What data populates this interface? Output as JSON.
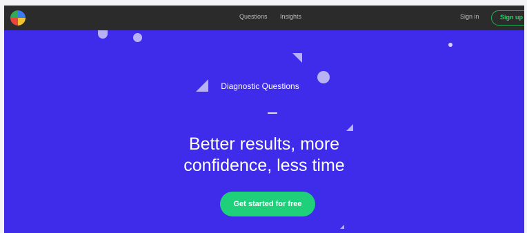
{
  "nav": {
    "links": [
      "Questions",
      "Insights"
    ],
    "sign_in": "Sign in",
    "sign_up": "Sign up"
  },
  "hero": {
    "label": "Diagnostic Questions",
    "headline_line1": "Better results, more",
    "headline_line2": "confidence, less time",
    "cta": "Get started for free"
  },
  "colors": {
    "background": "#3f2bea",
    "navbar": "#2b2b2b",
    "cta": "#1fd07a",
    "sign_up_border": "#1fb25a"
  }
}
